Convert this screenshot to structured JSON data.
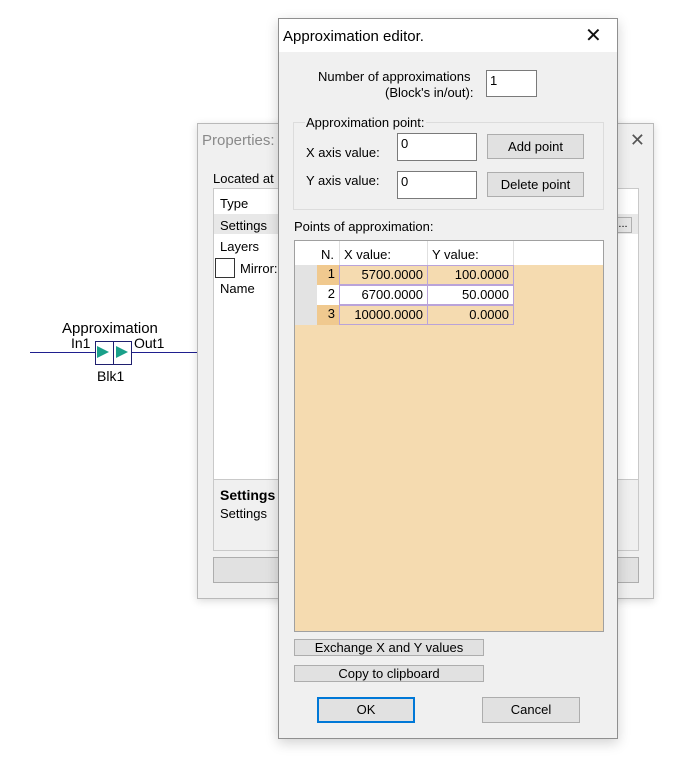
{
  "diagram": {
    "block_title": "Approximation",
    "in_port": "In1",
    "out_port": "Out1",
    "block_name": "Blk1"
  },
  "properties_window": {
    "title": "Properties:",
    "located_at": "Located at",
    "rows": [
      "Type",
      "Settings",
      "Layers",
      "Mirror:",
      "Name"
    ],
    "ellipsis": "...",
    "desc_title": "Settings",
    "desc_text": "Settings"
  },
  "dialog": {
    "title": "Approximation editor.",
    "num_label_line1": "Number of approximations",
    "num_label_line2": "(Block's in/out):",
    "num_value": "1",
    "group_label": "Approximation point:",
    "x_label": "X axis value:",
    "x_value": "0",
    "y_label": "Y axis value:",
    "y_value": "0",
    "add_point": "Add point",
    "delete_point": "Delete point",
    "points_label": "Points of approximation:",
    "columns": [
      "N.",
      "X value:",
      "Y value:"
    ],
    "rows": [
      {
        "n": "1",
        "x": "5700.0000",
        "y": "100.0000"
      },
      {
        "n": "2",
        "x": "6700.0000",
        "y": "50.0000"
      },
      {
        "n": "3",
        "x": "10000.0000",
        "y": "0.0000"
      }
    ],
    "exchange_btn": "Exchange X and Y values",
    "copy_btn": "Copy to clipboard",
    "ok": "OK",
    "cancel": "Cancel"
  },
  "colors": {
    "grid_bg": "#f5dbb0",
    "accent": "#0078d7",
    "arrow": "#1aa08a",
    "wire": "#1f1f8f"
  }
}
